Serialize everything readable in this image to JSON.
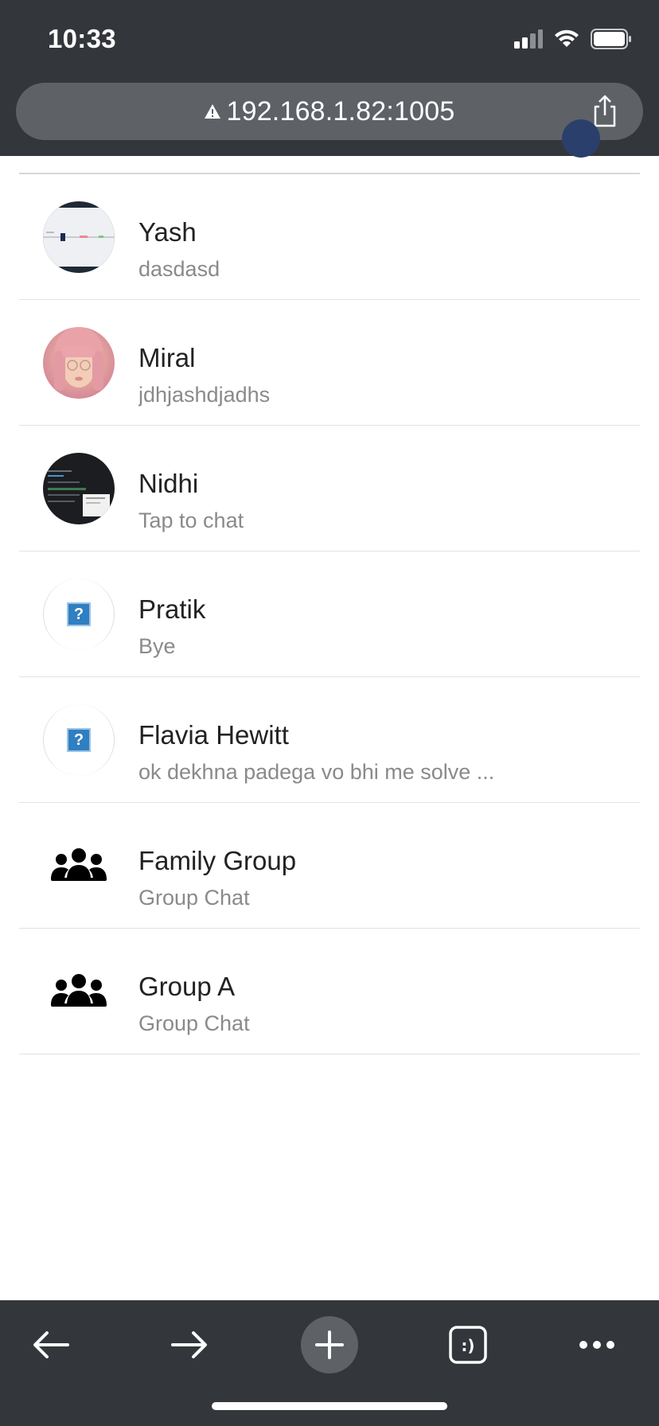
{
  "status_bar": {
    "time": "10:33"
  },
  "browser": {
    "url": "192.168.1.82:1005"
  },
  "chats": [
    {
      "name": "Yash",
      "message": "dasdasd",
      "avatar": "screenshot-thumbnail"
    },
    {
      "name": "Miral",
      "message": "jdhjashdjadhs",
      "avatar": "portrait-photo"
    },
    {
      "name": "Nidhi",
      "message": "Tap to chat",
      "avatar": "dark-screenshot-thumbnail"
    },
    {
      "name": "Pratik",
      "message": "Bye",
      "avatar": "broken-image-icon"
    },
    {
      "name": "Flavia Hewitt",
      "message": "ok dekhna padega vo bhi me solve ...",
      "avatar": "broken-image-icon"
    },
    {
      "name": "Family Group",
      "message": "Group Chat",
      "avatar": "group-icon"
    },
    {
      "name": "Group A",
      "message": "Group Chat",
      "avatar": "group-icon"
    }
  ],
  "toolbar": {
    "tabs_label": ":)"
  },
  "colors": {
    "chrome_bg": "#33363a",
    "url_bar_bg": "#5e6266",
    "name_text": "#222222",
    "message_text": "#8a8a8a",
    "divider": "#e2e2e2"
  }
}
